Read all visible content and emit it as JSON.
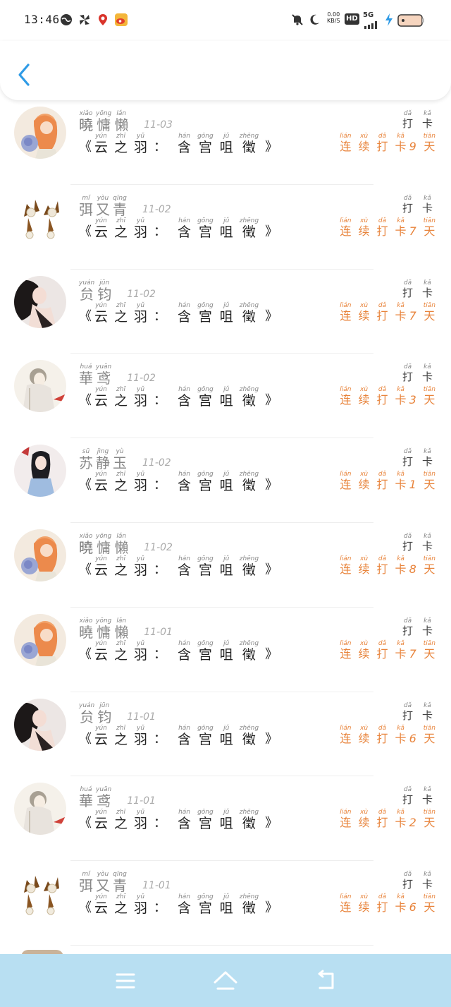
{
  "status_bar": {
    "time": "13:46",
    "net_speed": "0.00",
    "net_unit": "KB/S",
    "hd": "HD",
    "network": "5G"
  },
  "header": {
    "back_icon": "chevron-left-icon"
  },
  "entries": [
    {
      "avatar": "orange-hair-girl",
      "name": [
        [
          "xiǎo",
          "曉"
        ],
        [
          "yōng",
          "慵"
        ],
        [
          "lǎn",
          "懶"
        ]
      ],
      "date": "11-03",
      "title": [
        [
          "yún",
          "云"
        ],
        [
          "zhī",
          "之"
        ],
        [
          "yǔ",
          "羽"
        ],
        [
          "hán",
          "含"
        ],
        [
          "gōng",
          "宫"
        ],
        [
          "jǔ",
          "咀"
        ],
        [
          "zhēng",
          "徵"
        ]
      ],
      "checkin": [
        [
          "dǎ",
          "打"
        ],
        [
          "kǎ",
          "卡"
        ]
      ],
      "streak_prefix": [
        [
          "lián",
          "连"
        ],
        [
          "xù",
          "续"
        ],
        [
          "dǎ",
          "打"
        ],
        [
          "kǎ",
          "卡"
        ]
      ],
      "streak_days": "9",
      "streak_suffix": [
        [
          "tiān",
          "天"
        ]
      ]
    },
    {
      "avatar": "pearl-earrings",
      "name": [
        [
          "mǐ",
          "弭"
        ],
        [
          "yòu",
          "又"
        ],
        [
          "qīng",
          "青"
        ]
      ],
      "date": "11-02",
      "title": [
        [
          "yún",
          "云"
        ],
        [
          "zhī",
          "之"
        ],
        [
          "yǔ",
          "羽"
        ],
        [
          "hán",
          "含"
        ],
        [
          "gōng",
          "宫"
        ],
        [
          "jǔ",
          "咀"
        ],
        [
          "zhēng",
          "徵"
        ]
      ],
      "checkin": [
        [
          "dǎ",
          "打"
        ],
        [
          "kǎ",
          "卡"
        ]
      ],
      "streak_prefix": [
        [
          "lián",
          "连"
        ],
        [
          "xù",
          "续"
        ],
        [
          "dǎ",
          "打"
        ],
        [
          "kǎ",
          "卡"
        ]
      ],
      "streak_days": "7",
      "streak_suffix": [
        [
          "tiān",
          "天"
        ]
      ]
    },
    {
      "avatar": "dark-hair-woman",
      "name": [
        [
          "yuán",
          "贠"
        ],
        [
          "jūn",
          "钧"
        ]
      ],
      "date": "11-02",
      "title": [
        [
          "yún",
          "云"
        ],
        [
          "zhī",
          "之"
        ],
        [
          "yǔ",
          "羽"
        ],
        [
          "hán",
          "含"
        ],
        [
          "gōng",
          "宫"
        ],
        [
          "jǔ",
          "咀"
        ],
        [
          "zhēng",
          "徵"
        ]
      ],
      "checkin": [
        [
          "dǎ",
          "打"
        ],
        [
          "kǎ",
          "卡"
        ]
      ],
      "streak_prefix": [
        [
          "lián",
          "连"
        ],
        [
          "xù",
          "续"
        ],
        [
          "dǎ",
          "打"
        ],
        [
          "kǎ",
          "卡"
        ]
      ],
      "streak_days": "7",
      "streak_suffix": [
        [
          "tiān",
          "天"
        ]
      ]
    },
    {
      "avatar": "anime-guqin",
      "name": [
        [
          "huá",
          "華"
        ],
        [
          "yuān",
          "鸢"
        ]
      ],
      "date": "11-02",
      "title": [
        [
          "yún",
          "云"
        ],
        [
          "zhī",
          "之"
        ],
        [
          "yǔ",
          "羽"
        ],
        [
          "hán",
          "含"
        ],
        [
          "gōng",
          "宫"
        ],
        [
          "jǔ",
          "咀"
        ],
        [
          "zhēng",
          "徵"
        ]
      ],
      "checkin": [
        [
          "dǎ",
          "打"
        ],
        [
          "kǎ",
          "卡"
        ]
      ],
      "streak_prefix": [
        [
          "lián",
          "连"
        ],
        [
          "xù",
          "续"
        ],
        [
          "dǎ",
          "打"
        ],
        [
          "kǎ",
          "卡"
        ]
      ],
      "streak_days": "3",
      "streak_suffix": [
        [
          "tiān",
          "天"
        ]
      ]
    },
    {
      "avatar": "girl-blue-dress",
      "name": [
        [
          "sū",
          "苏"
        ],
        [
          "jìng",
          "静"
        ],
        [
          "yù",
          "玉"
        ]
      ],
      "date": "11-02",
      "title": [
        [
          "yún",
          "云"
        ],
        [
          "zhī",
          "之"
        ],
        [
          "yǔ",
          "羽"
        ],
        [
          "hán",
          "含"
        ],
        [
          "gōng",
          "宫"
        ],
        [
          "jǔ",
          "咀"
        ],
        [
          "zhēng",
          "徵"
        ]
      ],
      "checkin": [
        [
          "dǎ",
          "打"
        ],
        [
          "kǎ",
          "卡"
        ]
      ],
      "streak_prefix": [
        [
          "lián",
          "连"
        ],
        [
          "xù",
          "续"
        ],
        [
          "dǎ",
          "打"
        ],
        [
          "kǎ",
          "卡"
        ]
      ],
      "streak_days": "1",
      "streak_suffix": [
        [
          "tiān",
          "天"
        ]
      ]
    },
    {
      "avatar": "orange-hair-girl",
      "name": [
        [
          "xiǎo",
          "曉"
        ],
        [
          "yōng",
          "慵"
        ],
        [
          "lǎn",
          "懶"
        ]
      ],
      "date": "11-02",
      "title": [
        [
          "yún",
          "云"
        ],
        [
          "zhī",
          "之"
        ],
        [
          "yǔ",
          "羽"
        ],
        [
          "hán",
          "含"
        ],
        [
          "gōng",
          "宫"
        ],
        [
          "jǔ",
          "咀"
        ],
        [
          "zhēng",
          "徵"
        ]
      ],
      "checkin": [
        [
          "dǎ",
          "打"
        ],
        [
          "kǎ",
          "卡"
        ]
      ],
      "streak_prefix": [
        [
          "lián",
          "连"
        ],
        [
          "xù",
          "续"
        ],
        [
          "dǎ",
          "打"
        ],
        [
          "kǎ",
          "卡"
        ]
      ],
      "streak_days": "8",
      "streak_suffix": [
        [
          "tiān",
          "天"
        ]
      ]
    },
    {
      "avatar": "orange-hair-girl",
      "name": [
        [
          "xiǎo",
          "曉"
        ],
        [
          "yōng",
          "慵"
        ],
        [
          "lǎn",
          "懶"
        ]
      ],
      "date": "11-01",
      "title": [
        [
          "yún",
          "云"
        ],
        [
          "zhī",
          "之"
        ],
        [
          "yǔ",
          "羽"
        ],
        [
          "hán",
          "含"
        ],
        [
          "gōng",
          "宫"
        ],
        [
          "jǔ",
          "咀"
        ],
        [
          "zhēng",
          "徵"
        ]
      ],
      "checkin": [
        [
          "dǎ",
          "打"
        ],
        [
          "kǎ",
          "卡"
        ]
      ],
      "streak_prefix": [
        [
          "lián",
          "连"
        ],
        [
          "xù",
          "续"
        ],
        [
          "dǎ",
          "打"
        ],
        [
          "kǎ",
          "卡"
        ]
      ],
      "streak_days": "7",
      "streak_suffix": [
        [
          "tiān",
          "天"
        ]
      ]
    },
    {
      "avatar": "dark-hair-woman",
      "name": [
        [
          "yuán",
          "贠"
        ],
        [
          "jūn",
          "钧"
        ]
      ],
      "date": "11-01",
      "title": [
        [
          "yún",
          "云"
        ],
        [
          "zhī",
          "之"
        ],
        [
          "yǔ",
          "羽"
        ],
        [
          "hán",
          "含"
        ],
        [
          "gōng",
          "宫"
        ],
        [
          "jǔ",
          "咀"
        ],
        [
          "zhēng",
          "徵"
        ]
      ],
      "checkin": [
        [
          "dǎ",
          "打"
        ],
        [
          "kǎ",
          "卡"
        ]
      ],
      "streak_prefix": [
        [
          "lián",
          "连"
        ],
        [
          "xù",
          "续"
        ],
        [
          "dǎ",
          "打"
        ],
        [
          "kǎ",
          "卡"
        ]
      ],
      "streak_days": "6",
      "streak_suffix": [
        [
          "tiān",
          "天"
        ]
      ]
    },
    {
      "avatar": "anime-guqin",
      "name": [
        [
          "huá",
          "華"
        ],
        [
          "yuān",
          "鸢"
        ]
      ],
      "date": "11-01",
      "title": [
        [
          "yún",
          "云"
        ],
        [
          "zhī",
          "之"
        ],
        [
          "yǔ",
          "羽"
        ],
        [
          "hán",
          "含"
        ],
        [
          "gōng",
          "宫"
        ],
        [
          "jǔ",
          "咀"
        ],
        [
          "zhēng",
          "徵"
        ]
      ],
      "checkin": [
        [
          "dǎ",
          "打"
        ],
        [
          "kǎ",
          "卡"
        ]
      ],
      "streak_prefix": [
        [
          "lián",
          "连"
        ],
        [
          "xù",
          "续"
        ],
        [
          "dǎ",
          "打"
        ],
        [
          "kǎ",
          "卡"
        ]
      ],
      "streak_days": "2",
      "streak_suffix": [
        [
          "tiān",
          "天"
        ]
      ]
    },
    {
      "avatar": "pearl-earrings",
      "name": [
        [
          "mǐ",
          "弭"
        ],
        [
          "yòu",
          "又"
        ],
        [
          "qīng",
          "青"
        ]
      ],
      "date": "11-01",
      "title": [
        [
          "yún",
          "云"
        ],
        [
          "zhī",
          "之"
        ],
        [
          "yǔ",
          "羽"
        ],
        [
          "hán",
          "含"
        ],
        [
          "gōng",
          "宫"
        ],
        [
          "jǔ",
          "咀"
        ],
        [
          "zhēng",
          "徵"
        ]
      ],
      "checkin": [
        [
          "dǎ",
          "打"
        ],
        [
          "kǎ",
          "卡"
        ]
      ],
      "streak_prefix": [
        [
          "lián",
          "连"
        ],
        [
          "xù",
          "续"
        ],
        [
          "dǎ",
          "打"
        ],
        [
          "kǎ",
          "卡"
        ]
      ],
      "streak_days": "6",
      "streak_suffix": [
        [
          "tiān",
          "天"
        ]
      ]
    }
  ],
  "navbar": {
    "menu_icon": "menu-icon",
    "home_icon": "home-icon",
    "back_icon": "back-arrow-icon",
    "color": "#b8dff2"
  },
  "colors": {
    "accent_blue": "#2f9be6",
    "streak_orange": "#e8843c"
  }
}
